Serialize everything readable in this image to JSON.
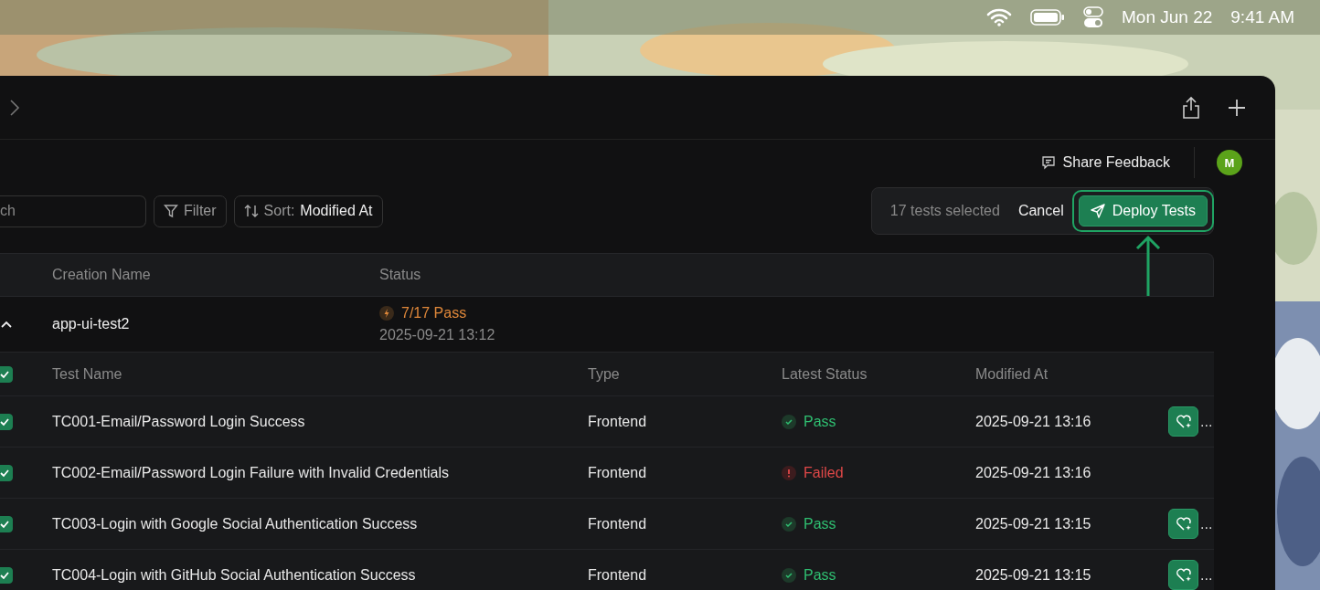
{
  "menu_bar": {
    "date": "Mon Jun 22",
    "time": "9:41 AM"
  },
  "header": {
    "feedback": "Share Feedback",
    "avatar": "M"
  },
  "toolbar": {
    "search": {
      "placeholder": "ch"
    },
    "filter": "Filter",
    "sort": {
      "label": "Sort:",
      "value": "Modified At"
    }
  },
  "selection_bar": {
    "count": "17 tests selected",
    "cancel": "Cancel",
    "deploy": "Deploy Tests",
    "highlighted": true
  },
  "table": {
    "columns": [
      "Creation Name",
      "Status"
    ],
    "group": {
      "name": "app-ui-test2",
      "expanded": true,
      "status": "7/17 Pass",
      "date": "2025-09-21 13:12"
    },
    "sub_columns": [
      "Test Name",
      "Type",
      "Latest Status",
      "Modified At"
    ],
    "all_checked": true,
    "rows": [
      {
        "checked": true,
        "name": "TC001-Email/Password Login Success",
        "type": "Frontend",
        "status": "Pass",
        "kind": "pass",
        "modified": "2025-09-21 13:16",
        "action": true,
        "more": "..."
      },
      {
        "checked": true,
        "name": "TC002-Email/Password Login Failure with Invalid Credentials",
        "type": "Frontend",
        "status": "Failed",
        "kind": "failed",
        "modified": "2025-09-21 13:16",
        "action": false
      },
      {
        "checked": true,
        "name": "TC003-Login with Google Social Authentication Success",
        "type": "Frontend",
        "status": "Pass",
        "kind": "pass",
        "modified": "2025-09-21 13:15",
        "action": true,
        "more": "..."
      },
      {
        "checked": true,
        "name": "TC004-Login with GitHub Social Authentication Success",
        "type": "Frontend",
        "status": "Pass",
        "kind": "pass",
        "modified": "2025-09-21 13:15",
        "action": true,
        "more": "..."
      }
    ]
  }
}
